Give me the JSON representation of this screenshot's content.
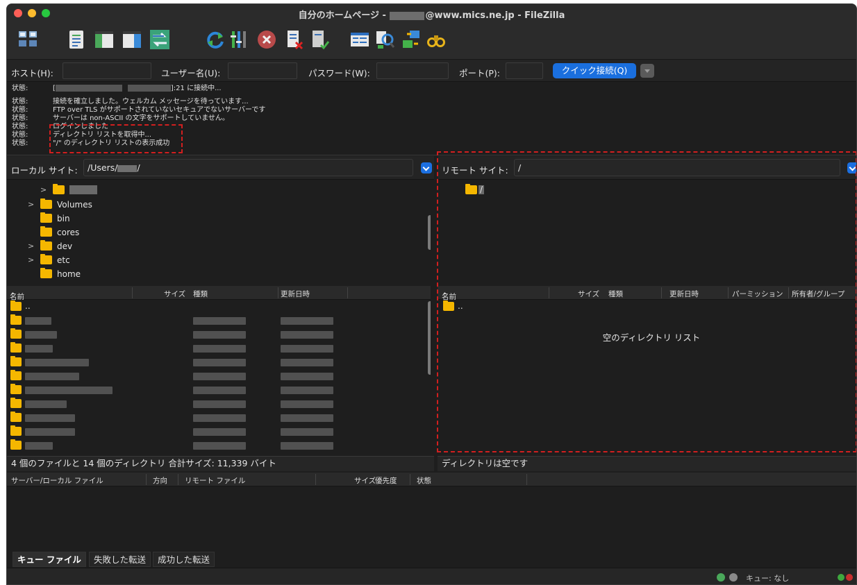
{
  "window": {
    "title_prefix": "自分のホームページ -",
    "title_suffix": "@www.mics.ne.jp - FileZilla"
  },
  "toolbar": {
    "buttons": [
      "site-manager",
      "toggle-message-log",
      "toggle-local-tree",
      "toggle-remote-tree",
      "toggle-transfer-queue",
      "refresh",
      "process-queue",
      "cancel",
      "disconnect",
      "reconnect",
      "directory-listing-filters",
      "compare-directories",
      "synchronized-browsing",
      "search-remote-files"
    ]
  },
  "quickconnect": {
    "host_label": "ホスト(H):",
    "user_label": "ユーザー名(U):",
    "password_label": "パスワード(W):",
    "port_label": "ポート(P):",
    "button_label": "クイック接続(Q)",
    "host_value": "",
    "user_value": "",
    "password_value": "",
    "port_value": ""
  },
  "log": {
    "status_key": "状態:",
    "lines": [
      "[",
      "接続を確立しました。ウェルカム メッセージを待っています...",
      "FTP over TLS がサポートされていないセキュアでないサーバーです",
      "サーバーは non-ASCII の文字をサポートしていません。",
      "ログインしました",
      "ディレクトリ リストを取得中...",
      "\"/\" のディレクトリ リストの表示成功"
    ],
    "line0_suffix": "]:21 に接続中..."
  },
  "local": {
    "site_label": "ローカル サイト:",
    "path_prefix": "/Users/",
    "path_suffix": "/",
    "tree": [
      {
        "name": "",
        "expandable": true
      },
      {
        "name": "Volumes",
        "expandable": true
      },
      {
        "name": "bin",
        "expandable": false
      },
      {
        "name": "cores",
        "expandable": false
      },
      {
        "name": "dev",
        "expandable": true
      },
      {
        "name": "etc",
        "expandable": true
      },
      {
        "name": "home",
        "expandable": false
      }
    ],
    "columns": [
      "名前",
      "サイズ",
      "種類",
      "更新日時"
    ],
    "parent_entry": "..",
    "status": "4 個のファイルと 14 個のディレクトリ 合計サイズ: 11,339 バイト"
  },
  "remote": {
    "site_label": "リモート サイト:",
    "path": "/",
    "tree_root": "/",
    "columns": [
      "名前",
      "サイズ",
      "種類",
      "更新日時",
      "パーミッション",
      "所有者/グループ"
    ],
    "parent_entry": "..",
    "empty_text": "空のディレクトリ リスト",
    "status": "ディレクトリは空です"
  },
  "queue": {
    "columns": [
      "サーバー/ローカル ファイル",
      "方向",
      "リモート ファイル",
      "サイズ",
      "優先度",
      "状態"
    ],
    "tabs": [
      "キュー ファイル",
      "失敗した転送",
      "成功した転送"
    ],
    "active_tab": "キュー ファイル",
    "queue_status": "キュー: なし"
  },
  "colors": {
    "accent": "#1a6fde",
    "folder": "#f5b700",
    "highlight": "#d21f1f",
    "background": "#1e1e1e"
  }
}
